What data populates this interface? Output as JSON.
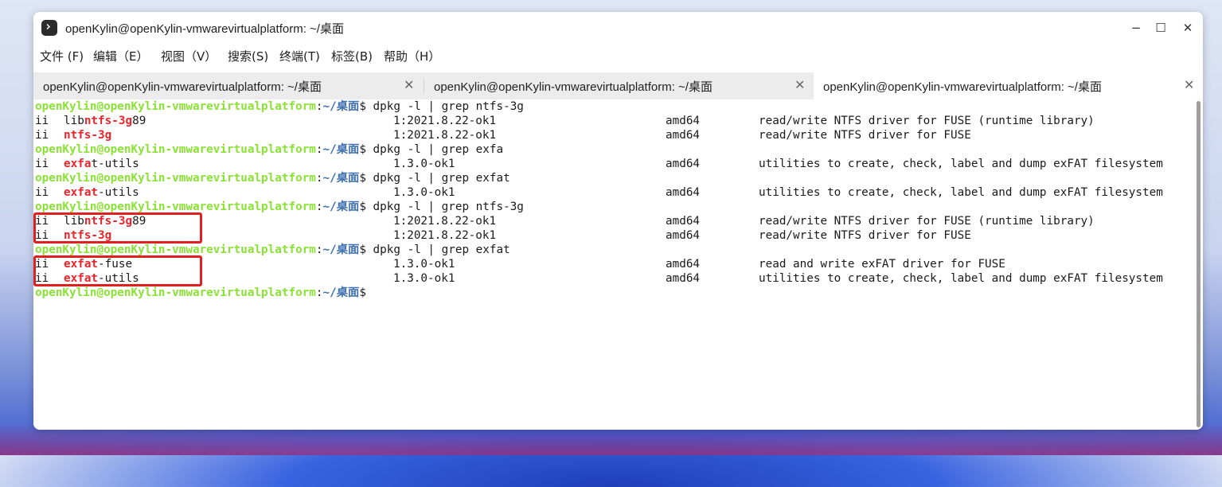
{
  "window": {
    "title": "openKylin@openKylin-vmwarevirtualplatform: ~/桌面",
    "controls": {
      "minimize": "−",
      "maximize": "☐",
      "close": "✕"
    }
  },
  "menu": [
    {
      "label": "文件 (F)"
    },
    {
      "label": "编辑（E）"
    },
    {
      "label": "视图（V）"
    },
    {
      "label": "搜索(S)"
    },
    {
      "label": "终端(T)"
    },
    {
      "label": "标签(B)"
    },
    {
      "label": "帮助（H）"
    }
  ],
  "tabs": [
    {
      "label": "openKylin@openKylin-vmwarevirtualplatform: ~/桌面",
      "close": "✕"
    },
    {
      "label": "openKylin@openKylin-vmwarevirtualplatform: ~/桌面",
      "close": "✕"
    },
    {
      "label": "openKylin@openKylin-vmwarevirtualplatform: ~/桌面",
      "close": "✕",
      "active": true
    }
  ],
  "prompt": {
    "user": "openKylin@openKylin-vmwarevirtualplatform",
    "sep": ":",
    "path": "~/桌面",
    "dollar": "$"
  },
  "terminal": {
    "cmd1": "dpkg -l | grep ntfs-3g",
    "cmd2": "dpkg -l | grep exfa",
    "cmd3": "dpkg -l | grep exfat",
    "cmd4": "dpkg -l | grep ntfs-3g",
    "cmd5": "dpkg -l | grep exfat",
    "status": "ii",
    "lib": "lib",
    "ntfs3g": "ntfs-3g",
    "num89": "89",
    "exfat": "exfat",
    "exfa": "exfa",
    "t_utils": "t-utils",
    "utils": "-utils",
    "fuse": "-fuse",
    "ver_ntfs": "1:2021.8.22-ok1",
    "ver_exfat": "1.3.0-ok1",
    "arch": "amd64",
    "desc_ntfs_lib": "read/write NTFS driver for FUSE (runtime library)",
    "desc_ntfs": "read/write NTFS driver for FUSE",
    "desc_exfat_utils": "utilities to create, check, label and dump exFAT filesystem",
    "desc_exfat_fuse": "read and write exFAT driver for FUSE"
  }
}
